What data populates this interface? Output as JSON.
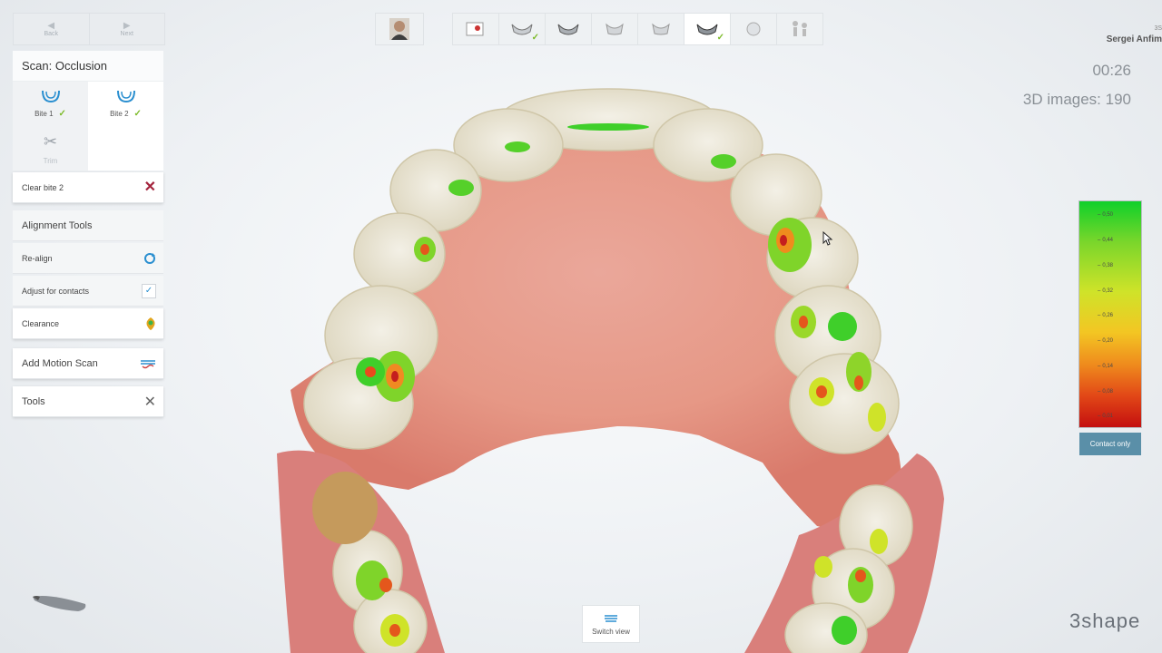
{
  "nav": {
    "back": "Back",
    "next": "Next"
  },
  "scan_title": "Scan: Occlusion",
  "bites": [
    {
      "label": "Bite 1",
      "done": true
    },
    {
      "label": "Bite 2",
      "done": true
    }
  ],
  "trim_label": "Trim",
  "clear_label": "Clear bite 2",
  "alignment": {
    "header": "Alignment Tools",
    "realign": "Re-align",
    "adjust": "Adjust for contacts",
    "clearance": "Clearance"
  },
  "motion_label": "Add Motion Scan",
  "tools_label": "Tools",
  "user": {
    "id": "3S",
    "name": "Sergei Anfim"
  },
  "timer": "00:26",
  "images_count": "3D images: 190",
  "legend_ticks": [
    "0,50",
    "0,44",
    "0,38",
    "0,32",
    "0,26",
    "0,20",
    "0,14",
    "0,08",
    "0,01"
  ],
  "contact_button": "Contact only",
  "switch_view": "Switch view",
  "brand": "3shape",
  "colors": {
    "accent": "#5a8fa8",
    "check": "#7dbb2a",
    "danger": "#a3233c"
  },
  "icons": [
    "arrow-left-icon",
    "arrow-right-icon",
    "upper-jaw-icon",
    "scissors-icon",
    "close-icon",
    "realign-icon",
    "checkbox-icon",
    "clearance-icon",
    "motion-icon",
    "tools-icon",
    "patient-avatar-icon",
    "switch-view-icon",
    "scanner-wand-icon",
    "cursor-icon"
  ]
}
